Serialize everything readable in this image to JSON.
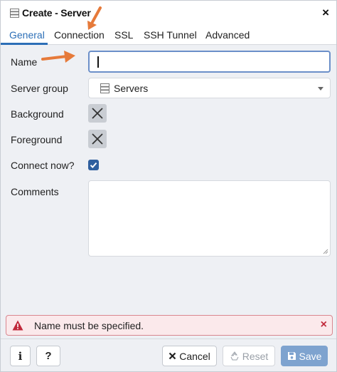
{
  "window": {
    "title": "Create - Server",
    "close_icon": "×"
  },
  "tabs": [
    {
      "label": "General",
      "active": true
    },
    {
      "label": "Connection",
      "active": false
    },
    {
      "label": "SSL",
      "active": false
    },
    {
      "label": "SSH Tunnel",
      "active": false
    },
    {
      "label": "Advanced",
      "active": false
    }
  ],
  "form": {
    "name_label": "Name",
    "name_value": "",
    "server_group_label": "Server group",
    "server_group_value": "Servers",
    "background_label": "Background",
    "foreground_label": "Foreground",
    "connect_now_label": "Connect now?",
    "connect_now_checked": true,
    "comments_label": "Comments",
    "comments_value": ""
  },
  "error": {
    "message": "Name must be specified.",
    "close_icon": "×"
  },
  "footer": {
    "info_label": "i",
    "help_label": "?",
    "cancel_label": "Cancel",
    "reset_label": "Reset",
    "save_label": "Save"
  },
  "colors": {
    "accent": "#2c6fb7",
    "annotation_arrow": "#e67a3a",
    "error_border": "#d9868f",
    "error_bg": "#fbe9eb",
    "save_bg": "#7ea3cf"
  },
  "icons": {
    "title": "server-icon",
    "select": "server-group-icon",
    "error": "warning-triangle-icon",
    "cancel": "x-icon",
    "reset": "recycle-icon",
    "save": "floppy-disk-icon"
  }
}
